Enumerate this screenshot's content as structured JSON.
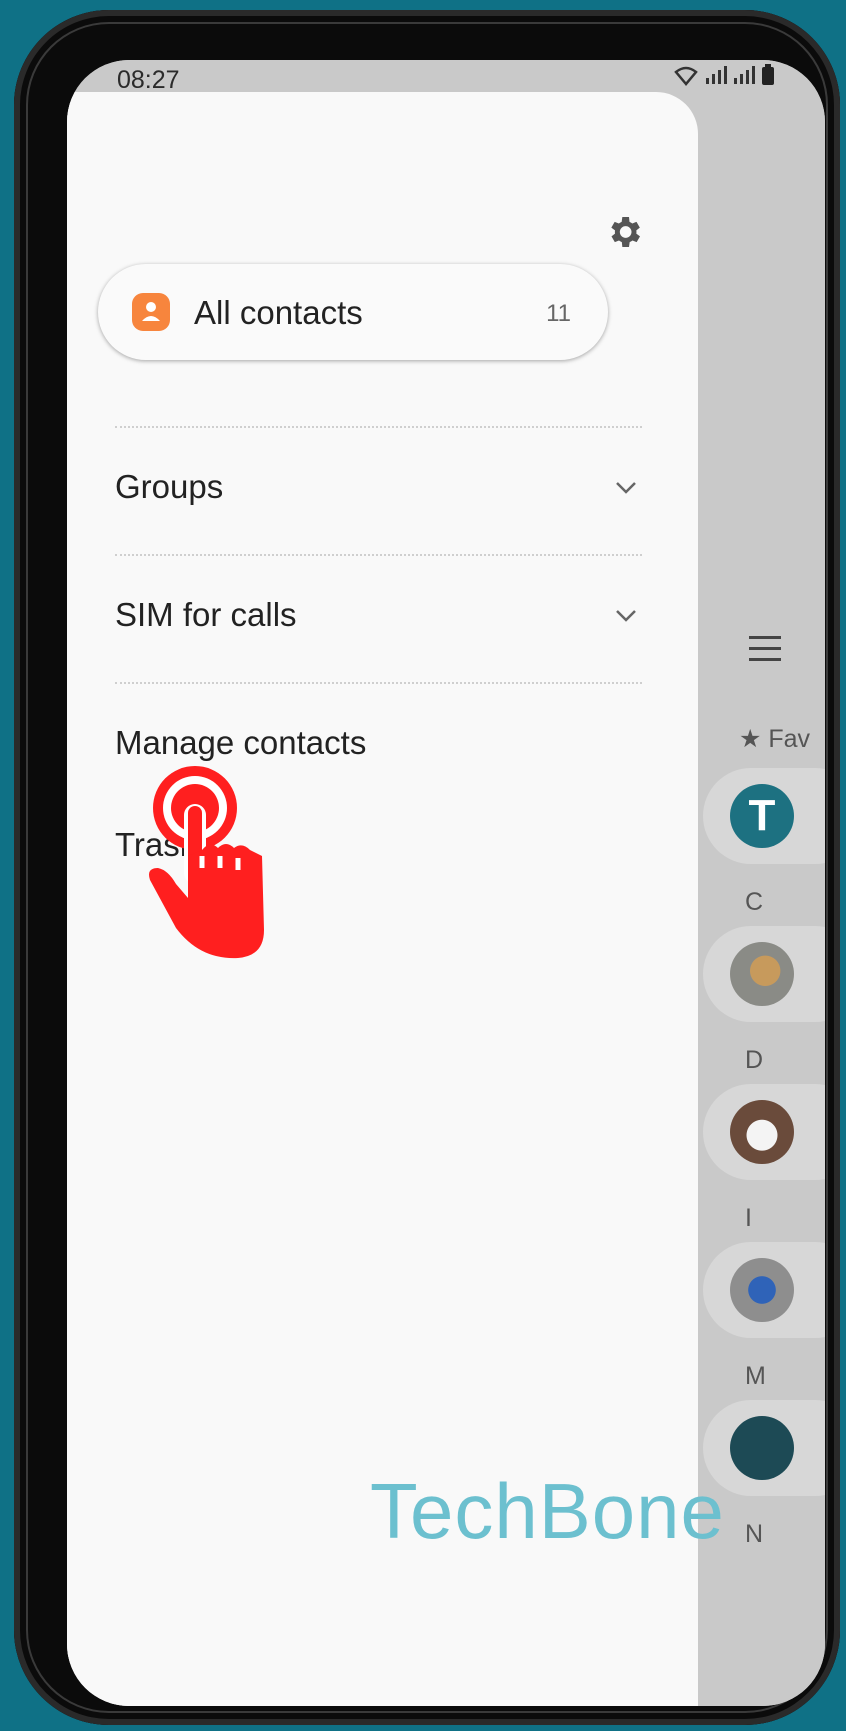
{
  "status": {
    "time": "08:27"
  },
  "drawer": {
    "all_contacts": {
      "label": "All contacts",
      "count": "11"
    },
    "items": [
      {
        "label": "Groups"
      },
      {
        "label": "SIM for calls"
      },
      {
        "label": "Manage contacts"
      },
      {
        "label": "Trash"
      }
    ]
  },
  "background_list": {
    "favorites_label": "Fav",
    "favorite_avatar_initial": "T",
    "section_letters": [
      "C",
      "D",
      "I",
      "M",
      "N"
    ]
  },
  "watermark": "TechBone",
  "colors": {
    "accent": "#f7853d",
    "pointer": "#ff1f1f",
    "watermark": "#6cc0cf",
    "frame_bg": "#0f7186"
  }
}
